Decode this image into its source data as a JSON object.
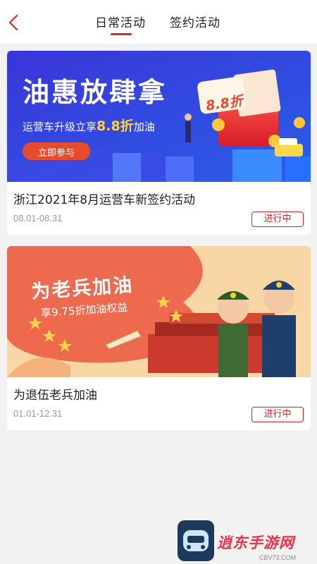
{
  "header": {
    "back_icon": "chevron-left-icon",
    "tabs": [
      {
        "label": "日常活动",
        "active": true
      },
      {
        "label": "签约活动",
        "active": false
      }
    ],
    "accent_color": "#d22c2c"
  },
  "activities": [
    {
      "banner": {
        "headline": "油惠放肆拿",
        "subline_prefix": "运营车升级立享",
        "subline_highlight": "8.8折",
        "subline_suffix": "加油",
        "button_label": "立即参与",
        "badge": "8.8折"
      },
      "title": "浙江2021年8月运营车新签约活动",
      "date_range": "08.01-08.31",
      "status": "进行中"
    },
    {
      "banner": {
        "headline": "为老兵加油",
        "subline": "享9.75折加油权益"
      },
      "title": "为退伍老兵加油",
      "date_range": "01.01-12.31",
      "status": "进行中"
    }
  ],
  "watermark": {
    "text": "逍东手游网",
    "sub": "CBV73.COM"
  }
}
